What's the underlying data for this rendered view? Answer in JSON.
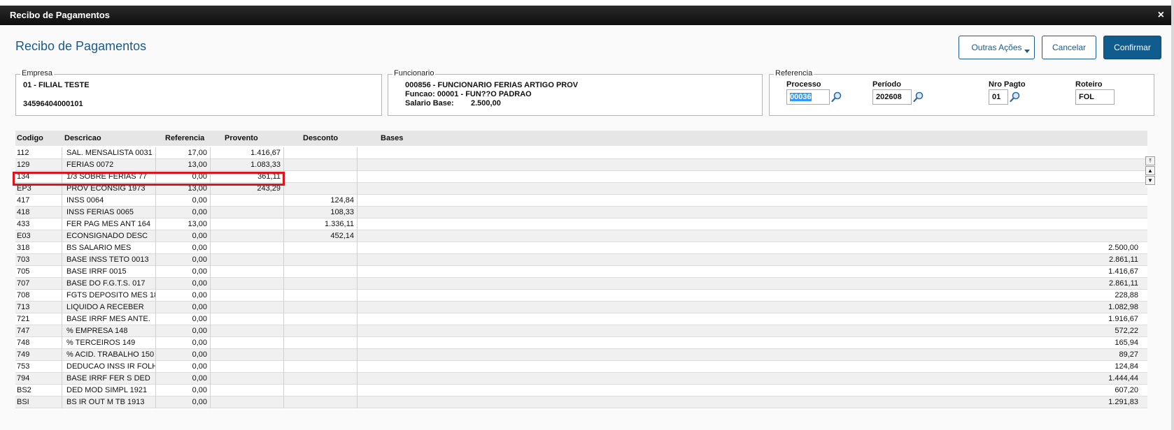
{
  "window": {
    "title": "Recibo de Pagamentos",
    "close_glyph": "×"
  },
  "page": {
    "title": "Recibo de Pagamentos"
  },
  "actions": {
    "outras": "Outras Ações",
    "cancelar": "Cancelar",
    "confirmar": "Confirmar"
  },
  "empresa": {
    "legend": "Empresa",
    "nome": "01 - FILIAL TESTE",
    "cnpj": "34596404000101"
  },
  "funcionario": {
    "legend": "Funcionario",
    "nome": "000856 - FUNCIONARIO FERIAS ARTIGO PROV",
    "funcao": "Funcao: 00001 - FUN??O PADRAO",
    "salario_label": "Salario Base:",
    "salario_valor": "2.500,00"
  },
  "referencia": {
    "legend": "Referencia",
    "processo_label": "Processo",
    "processo_value": "00036",
    "periodo_label": "Período",
    "periodo_value": "202608",
    "nro_label": "Nro Pagto",
    "nro_value": "01",
    "roteiro_label": "Roteiro",
    "roteiro_value": "FOL"
  },
  "grid": {
    "headers": [
      "Codigo",
      "Descricao",
      "Referencia",
      "Provento",
      "Desconto",
      "Bases"
    ],
    "rows": [
      [
        "112",
        "SAL. MENSALISTA 0031",
        "17,00",
        "1.416,67",
        "",
        ""
      ],
      [
        "129",
        "FERIAS 0072",
        "13,00",
        "1.083,33",
        "",
        ""
      ],
      [
        "134",
        "1/3 SOBRE FERIAS 77",
        "0,00",
        "361,11",
        "",
        ""
      ],
      [
        "EP3",
        "PROV ECONSIG 1973",
        "13,00",
        "243,29",
        "",
        ""
      ],
      [
        "417",
        "INSS 0064",
        "0,00",
        "",
        "124,84",
        ""
      ],
      [
        "418",
        "INSS FERIAS 0065",
        "0,00",
        "",
        "108,33",
        ""
      ],
      [
        "433",
        "FER PAG MES ANT 164",
        "13,00",
        "",
        "1.336,11",
        ""
      ],
      [
        "E03",
        "ECONSIGNADO DESC",
        "0,00",
        "",
        "452,14",
        ""
      ],
      [
        "318",
        "BS SALARIO MES",
        "0,00",
        "",
        "",
        "2.500,00"
      ],
      [
        "703",
        "BASE INSS TETO 0013",
        "0,00",
        "",
        "",
        "2.861,11"
      ],
      [
        "705",
        "BASE IRRF 0015",
        "0,00",
        "",
        "",
        "1.416,67"
      ],
      [
        "707",
        "BASE DO F.G.T.S. 017",
        "0,00",
        "",
        "",
        "2.861,11"
      ],
      [
        "708",
        "FGTS DEPOSITO MES 18",
        "0,00",
        "",
        "",
        "228,88"
      ],
      [
        "713",
        "LIQUIDO A RECEBER",
        "0,00",
        "",
        "",
        "1.082,98"
      ],
      [
        "721",
        "BASE IRRF MES ANTE.",
        "0,00",
        "",
        "",
        "1.916,67"
      ],
      [
        "747",
        "% EMPRESA  148",
        "0,00",
        "",
        "",
        "572,22"
      ],
      [
        "748",
        "% TERCEIROS 149",
        "0,00",
        "",
        "",
        "165,94"
      ],
      [
        "749",
        "% ACID. TRABALHO 150",
        "0,00",
        "",
        "",
        "89,27"
      ],
      [
        "753",
        "DEDUCAO INSS IR FOLH",
        "0,00",
        "",
        "",
        "124,84"
      ],
      [
        "794",
        "BASE IRRF FER S DED",
        "0,00",
        "",
        "",
        "1.444,44"
      ],
      [
        "BS2",
        "DED MOD SIMPL 1921",
        "0,00",
        "",
        "",
        "607,20"
      ],
      [
        "BSI",
        "BS IR OUT M TB 1913",
        "0,00",
        "",
        "",
        "1.291,83"
      ]
    ]
  },
  "highlight_color": "#e0141e",
  "accent_color": "#1b5a8a"
}
